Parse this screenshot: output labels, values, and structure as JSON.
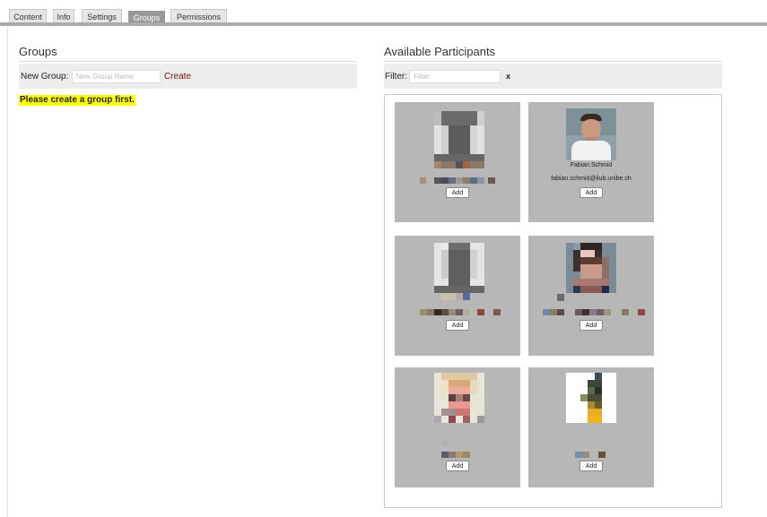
{
  "tabs": [
    {
      "label": "Content"
    },
    {
      "label": "Info"
    },
    {
      "label": "Settings"
    },
    {
      "label": "Groups",
      "active": true
    },
    {
      "label": "Permissions"
    }
  ],
  "groups": {
    "title": "Groups",
    "new_group_label": "New Group:",
    "new_group_placeholder": "New Group Name",
    "new_group_value": "",
    "create_label": "Create",
    "warning": "Please create a group first."
  },
  "participants": {
    "title": "Available Participants",
    "filter_label": "Filter:",
    "filter_placeholder": "Filter",
    "filter_value": "",
    "clear_label": "x",
    "cards": [
      {
        "name": "",
        "email": "",
        "add_label": "Add"
      },
      {
        "name": "Fabian Schmid",
        "email": "fabian.schmid@ilub.unibe.ch",
        "add_label": "Add"
      },
      {
        "name": "",
        "email": "",
        "add_label": "Add"
      },
      {
        "name": "",
        "email": "",
        "add_label": "Add"
      },
      {
        "name": "",
        "email": "",
        "add_label": "Add"
      },
      {
        "name": "",
        "email": "",
        "add_label": "Add"
      }
    ]
  },
  "colors": {
    "card_bg": "#b7b7b7",
    "warning_bg": "#ffff00",
    "create_link": "#7b1010",
    "active_tab": "#999999"
  }
}
